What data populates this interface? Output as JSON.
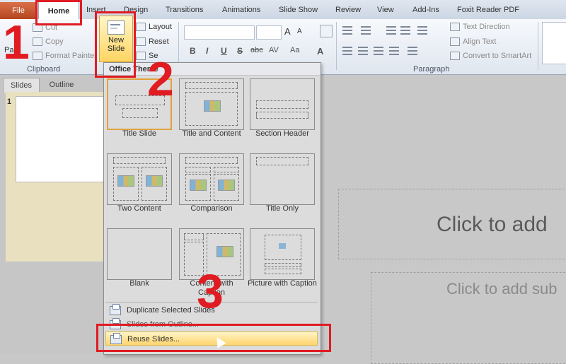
{
  "tabs": {
    "file": "File",
    "home": "Home",
    "insert": "Insert",
    "design": "Design",
    "transitions": "Transitions",
    "animations": "Animations",
    "slideshow": "Slide Show",
    "review": "Review",
    "view": "View",
    "addins": "Add-Ins",
    "foxit": "Foxit Reader PDF"
  },
  "ribbon": {
    "paste": "Pas",
    "cut": "Cut",
    "copy": "Copy",
    "format_painter": "Format Painter",
    "clipboard_group": "Clipboard",
    "new_slide_line1": "New",
    "new_slide_line2": "Slide",
    "layout": "Layout",
    "reset": "Reset",
    "section": "Se",
    "paragraph_group": "Paragraph",
    "text_direction": "Text Direction",
    "align_text": "Align Text",
    "convert_smartart": "Convert to SmartArt",
    "bold": "B",
    "italic": "I",
    "underline": "U",
    "strike": "S",
    "abc": "abc",
    "av": "AV",
    "aa": "Aa",
    "font_grow": "A",
    "font_shrink": "A"
  },
  "left_panel": {
    "slides_tab": "Slides",
    "outline_tab": "Outline",
    "slide_number": "1"
  },
  "dropdown": {
    "header": "Office Theme",
    "layouts": [
      "Title Slide",
      "Title and Content",
      "Section Header",
      "Two Content",
      "Comparison",
      "Title Only",
      "Blank",
      "Content with Caption",
      "Picture with Caption"
    ],
    "menu": {
      "duplicate": "Duplicate Selected Slides",
      "from_outline": "Slides from Outline...",
      "reuse": "Reuse Slides..."
    }
  },
  "slide": {
    "title_placeholder": "Click to add",
    "subtitle_placeholder": "Click to add sub"
  },
  "annotations": {
    "step1": "1",
    "step2": "2",
    "step3": "3",
    "color": "#e01b22"
  }
}
